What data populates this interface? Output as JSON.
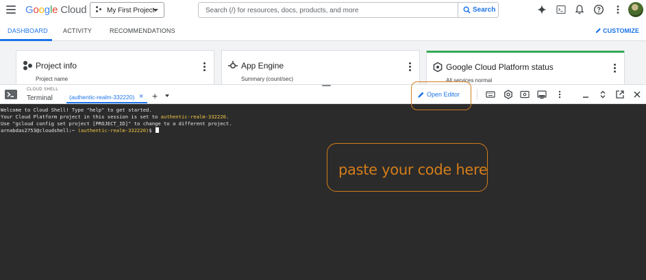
{
  "topbar": {
    "logo": {
      "letters": [
        "G",
        "o",
        "o",
        "g",
        "l",
        "e"
      ],
      "suffix": "Cloud"
    },
    "project_label": "My First Project",
    "search_placeholder": "Search (/) for resources, docs, products, and more",
    "search_button": "Search",
    "icons": [
      "menu-icon",
      "gemini-sparkle-icon",
      "cloud-shell-icon",
      "notifications-bell-icon",
      "help-icon",
      "more-vert-icon",
      "avatar"
    ]
  },
  "tabs": {
    "items": [
      "DASHBOARD",
      "ACTIVITY",
      "RECOMMENDATIONS"
    ],
    "active": "DASHBOARD",
    "customize": "CUSTOMIZE"
  },
  "cards": [
    {
      "title": "Project info",
      "subtitle": "Project name",
      "icon": "project-info-icon"
    },
    {
      "title": "App Engine",
      "subtitle": "Summary (count/sec)",
      "icon": "app-engine-icon"
    },
    {
      "title": "Google Cloud Platform status",
      "subtitle": "All services normal",
      "icon": "status-icon"
    }
  ],
  "shell": {
    "title": "CLOUD SHELL",
    "terminal_label": "Terminal",
    "tab_label": "(authentic-realm-332220)",
    "open_editor": "Open Editor",
    "toolbar_icons": [
      "keyboard-icon",
      "settings-icon",
      "web-preview-icon",
      "display-icon",
      "more-vert-icon",
      "minimize-icon",
      "expand-icon",
      "open-new-window-icon",
      "close-icon"
    ]
  },
  "terminal": {
    "welcome": "Welcome to Cloud Shell! Type \"help\" to get started.",
    "project_prefix": "Your Cloud Platform project in this session is set to ",
    "project_id": "authentic-realm-332220",
    "project_suffix": ".",
    "hint": "Use \"gcloud config set project [PROJECT_ID]\" to change to a different project.",
    "prompt_user": "arnabdas2753@cloudshell:~ ",
    "prompt_project": "(authentic-realm-332220)",
    "prompt_end": "$ "
  },
  "annotation": {
    "paste_text": "paste your code here",
    "color": "#d47d1a"
  },
  "colors": {
    "accent": "#1a73e8",
    "terminal_bg": "#2b2b2b",
    "status_green": "#34a853",
    "project_yellow": "#f2c744"
  }
}
